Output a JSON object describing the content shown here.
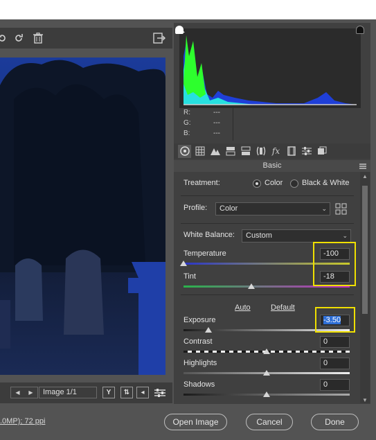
{
  "toolbar": {
    "icons": [
      "rotate-left-icon",
      "rotate-right-icon",
      "trash-icon",
      "export-icon"
    ]
  },
  "navigation": {
    "image_counter": "Image 1/1",
    "tools": [
      "Y",
      "swap-icon",
      "back-icon",
      "settings-icon"
    ]
  },
  "histogram": {
    "channels": [
      "R:",
      "G:",
      "B:"
    ],
    "values": [
      "---",
      "---",
      "---"
    ]
  },
  "panel": {
    "section_title": "Basic",
    "tabs": [
      "basic-icon",
      "tone-curve-icon",
      "detail-icon",
      "hsl-icon",
      "split-tone-icon",
      "lens-icon",
      "effects-icon",
      "camera-calibration-icon",
      "presets-icon",
      "snapshots-icon"
    ]
  },
  "basic": {
    "treatment_label": "Treatment:",
    "treatment_options": [
      "Color",
      "Black & White"
    ],
    "treatment_selected": "Color",
    "profile_label": "Profile:",
    "profile_value": "Color",
    "wb_label": "White Balance:",
    "wb_value": "Custom",
    "temperature_label": "Temperature",
    "temperature_value": "-100",
    "tint_label": "Tint",
    "tint_value": "-18",
    "auto_label": "Auto",
    "default_label": "Default",
    "exposure_label": "Exposure",
    "exposure_value": "-3.50",
    "contrast_label": "Contrast",
    "contrast_value": "0",
    "highlights_label": "Highlights",
    "highlights_value": "0",
    "shadows_label": "Shadows",
    "shadows_value": "0"
  },
  "footer": {
    "info_link": ".0MP); 72 ppi",
    "open_image": "Open Image",
    "cancel": "Cancel",
    "done": "Done"
  },
  "colors": {
    "highlight_box": "#f0e000",
    "histogram_blue": "#1f3fd8",
    "histogram_green": "#2dff2d",
    "histogram_cyan": "#27e0e0"
  }
}
